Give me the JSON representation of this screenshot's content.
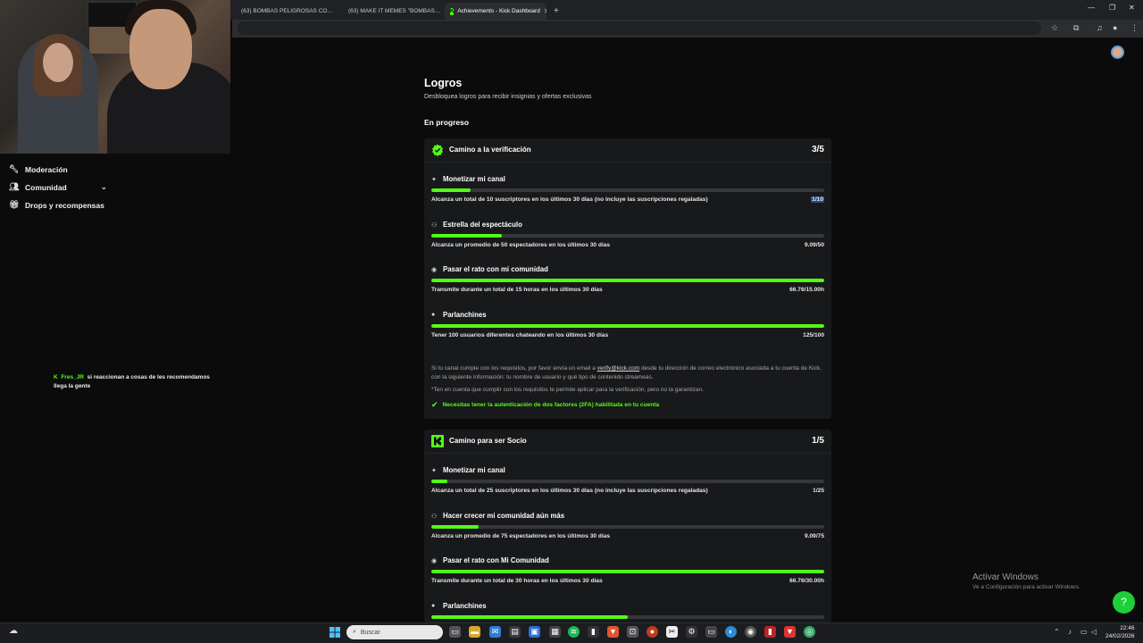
{
  "browser": {
    "tabs": [
      {
        "label": "(63) BOMBAS PELIGROSAS CO…",
        "favicon": "youtube-icon"
      },
      {
        "label": "(63) MAKE IT MEMES \"BOMBAS…",
        "favicon": "youtube-icon"
      },
      {
        "label": "Achievements - Kick Dashboard",
        "favicon": "kick-icon"
      }
    ],
    "new_tab": "+"
  },
  "sidebar": {
    "items": [
      {
        "label": "Moderación",
        "icon": "wrench-icon"
      },
      {
        "label": "Comunidad",
        "icon": "users-icon"
      },
      {
        "label": "Drops y recompensas",
        "icon": "gift-icon"
      }
    ]
  },
  "chat": {
    "user": "Fres_JR",
    "message": "si reaccionan a cosas de les recomendamos llega la gente"
  },
  "main": {
    "title": "Logros",
    "subtitle": "Desbloquea logros para recibir insignias y ofertas exclusivas",
    "section": "En progreso",
    "cards": [
      {
        "title": "Camino a la verificación",
        "count": "3/5",
        "requirements": [
          {
            "title": "Monetizar mi canal",
            "desc": "Alcanza un total de 10 suscriptores en los últimos 30 días (no incluye las suscripciones regaladas)",
            "value": "1/10",
            "progress": 0.1
          },
          {
            "title": "Estrella del espectáculo",
            "desc": "Alcanza un promedio de 50 espectadores en los últimos 30 días",
            "value": "9.09/50",
            "progress": 0.18
          },
          {
            "title": "Pasar el rato con mi comunidad",
            "desc": "Transmite durante un total de 15 horas en los últimos 30 días",
            "value": "66.76/15.00h",
            "progress": 1.0
          },
          {
            "title": "Parlanchines",
            "desc": "Tener 100 usuarios diferentes chateando en los últimos 30 días",
            "value": "125/100",
            "progress": 1.0
          }
        ],
        "note_pre": "Si tu canal cumple con los requisitos, por favor envía un email a ",
        "note_email": "verify@kick.com",
        "note_post": " desde tu dirección de correo electrónico asociada a tu cuenta de Kick, con la siguiente información: tu nombre de usuario y qué tipo de contenido streameas.",
        "note2": "*Ten en cuenta que cumplir con los requisitos te permite aplicar para la verificación, pero no la garantizan.",
        "twofa": "Necesitas tener la autenticación de dos factores (2FA) habilitada en tu cuenta"
      },
      {
        "title": "Camino para ser Socio",
        "count": "1/5",
        "requirements": [
          {
            "title": "Monetizar mi canal",
            "desc": "Alcanza un total de 25 suscriptores en los últimos 30 días (no incluye las suscripciones regaladas)",
            "value": "1/25",
            "progress": 0.04
          },
          {
            "title": "Hacer crecer mi comunidad aún más",
            "desc": "Alcanza un promedio de 75 espectadores en los últimos 30 días",
            "value": "9.09/75",
            "progress": 0.12
          },
          {
            "title": "Pasar el rato con Mi Comunidad",
            "desc": "Transmite durante un total de 30 horas en los últimos 30 días",
            "value": "66.76/30.00h",
            "progress": 1.0
          },
          {
            "title": "Parlanchines",
            "desc": "",
            "value": "",
            "progress": 0.5
          }
        ]
      }
    ]
  },
  "watermark": {
    "title": "Activar Windows",
    "subtitle": "Ve a Configuración para activar Windows."
  },
  "taskbar": {
    "search_placeholder": "Buscar",
    "time": "22:46",
    "date": "24/02/2026"
  },
  "colors": {
    "accent": "#53fc18",
    "card_bg": "#18191b",
    "page_bg": "#0b0b0c"
  }
}
